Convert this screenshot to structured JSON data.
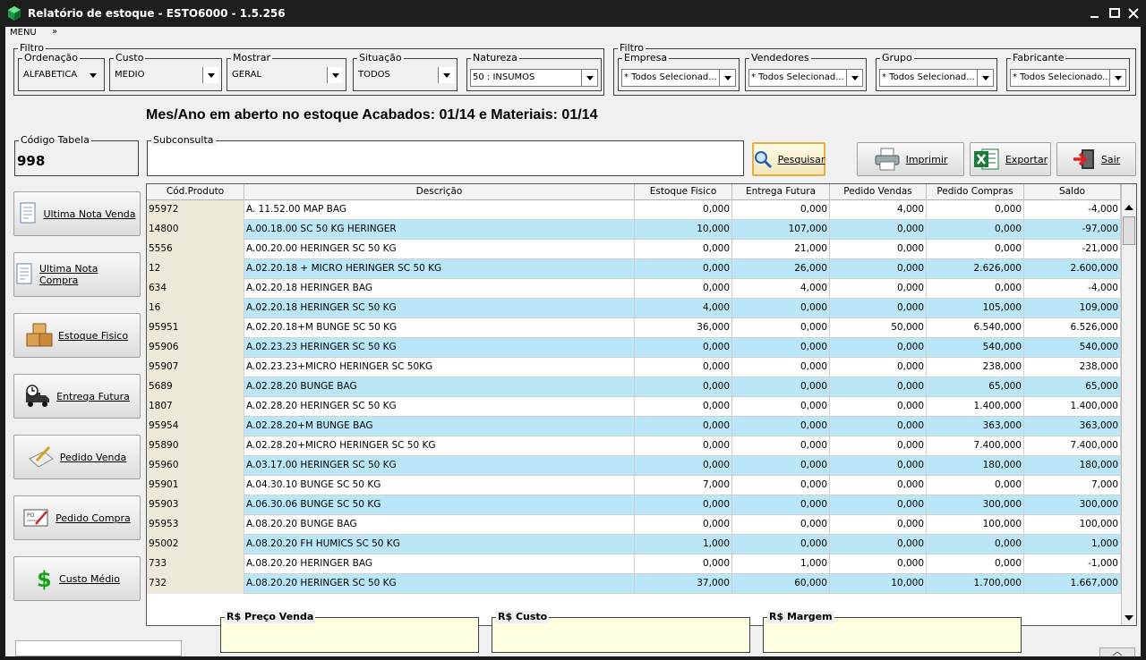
{
  "window": {
    "title": "Relatório de estoque - ESTO6000 - 1.5.256"
  },
  "menu": {
    "label": "MENU",
    "chevron": "»"
  },
  "filter_left": {
    "legend": "Filtro",
    "ordenacao": {
      "label": "Ordenação",
      "value": "ALFABÉTICA"
    },
    "custo": {
      "label": "Custo",
      "value": "MEDIO"
    },
    "mostrar": {
      "label": "Mostrar",
      "value": "GERAL"
    },
    "situacao": {
      "label": "Situação",
      "value": "TODOS"
    },
    "natureza": {
      "label": "Natureza",
      "value": "50 : INSUMOS"
    }
  },
  "filter_right": {
    "legend": "Filtro",
    "empresa": {
      "label": "Empresa",
      "value": "* Todos Selecionad..."
    },
    "vendedores": {
      "label": "Vendedores",
      "value": "* Todos Selecionad..."
    },
    "grupo": {
      "label": "Grupo",
      "value": "* Todos Selecionad..."
    },
    "fabricante": {
      "label": "Fabricante",
      "value": "* Todos Selecionado..."
    }
  },
  "banner": "Mes/Ano em aberto no estoque Acabados: 01/14 e Materiais: 01/14",
  "codigo_tabela": {
    "label": "Código Tabela",
    "value": "998"
  },
  "subconsulta": {
    "label": "Subconsulta",
    "value": ""
  },
  "actions": {
    "pesquisar": "Pesquisar",
    "imprimir": "Imprimir",
    "exportar": "Exportar",
    "sair": "Sair"
  },
  "side_buttons": {
    "ultima_nota_venda": "Ultima Nota Venda",
    "ultima_nota_compra": "Ultima Nota Compra",
    "estoque_fisico": "Estoque Fisico",
    "entrega_futura": "Entrega Futura",
    "pedido_venda": "Pedido Venda",
    "pedido_compra": "Pedido Compra",
    "custo_medio": "Custo Médio"
  },
  "grid": {
    "columns": [
      "Cód.Produto",
      "Descrição",
      "Estoque Fisico",
      "Entrega Futura",
      "Pedido Vendas",
      "Pedido Compras",
      "Saldo"
    ],
    "rows": [
      [
        "95972",
        "A. 11.52.00 MAP BAG",
        "0,000",
        "0,000",
        "4,000",
        "0,000",
        "-4,000"
      ],
      [
        "14800",
        "A.00.18.00 SC 50 KG HERINGER",
        "10,000",
        "107,000",
        "0,000",
        "0,000",
        "-97,000"
      ],
      [
        "5556",
        "A.00.20.00 HERINGER SC 50 KG",
        "0,000",
        "21,000",
        "0,000",
        "0,000",
        "-21,000"
      ],
      [
        "12",
        "A.02.20.18 + MICRO HERINGER SC 50 KG",
        "0,000",
        "26,000",
        "0,000",
        "2.626,000",
        "2.600,000"
      ],
      [
        "634",
        "A.02.20.18 HERINGER BAG",
        "0,000",
        "4,000",
        "0,000",
        "0,000",
        "-4,000"
      ],
      [
        "16",
        "A.02.20.18 HERINGER SC 50 KG",
        "4,000",
        "0,000",
        "0,000",
        "105,000",
        "109,000"
      ],
      [
        "95951",
        "A.02.20.18+M BUNGE SC 50 KG",
        "36,000",
        "0,000",
        "50,000",
        "6.540,000",
        "6.526,000"
      ],
      [
        "95906",
        "A.02.23.23 HERINGER SC 50 KG",
        "0,000",
        "0,000",
        "0,000",
        "540,000",
        "540,000"
      ],
      [
        "95907",
        "A.02.23.23+MICRO HERINGER SC 50KG",
        "0,000",
        "0,000",
        "0,000",
        "238,000",
        "238,000"
      ],
      [
        "5689",
        "A.02.28.20 BUNGE BAG",
        "0,000",
        "0,000",
        "0,000",
        "65,000",
        "65,000"
      ],
      [
        "1807",
        "A.02.28.20 HERINGER SC 50 KG",
        "0,000",
        "0,000",
        "0,000",
        "1.400,000",
        "1.400,000"
      ],
      [
        "95954",
        "A.02.28.20+M BUNGE BAG",
        "0,000",
        "0,000",
        "0,000",
        "363,000",
        "363,000"
      ],
      [
        "95890",
        "A.02.28.20+MICRO HERINGER SC 50 KG",
        "0,000",
        "0,000",
        "0,000",
        "7.400,000",
        "7.400,000"
      ],
      [
        "95960",
        "A.03.17.00 HERINGER SC 50 KG",
        "0,000",
        "0,000",
        "0,000",
        "180,000",
        "180,000"
      ],
      [
        "95901",
        "A.04.30.10 BUNGE SC 50 KG",
        "7,000",
        "0,000",
        "0,000",
        "0,000",
        "7,000"
      ],
      [
        "95903",
        "A.06.30.06 BUNGE SC 50 KG",
        "0,000",
        "0,000",
        "0,000",
        "300,000",
        "300,000"
      ],
      [
        "95953",
        "A.08.20.20 BUNGE BAG",
        "0,000",
        "0,000",
        "0,000",
        "100,000",
        "100,000"
      ],
      [
        "95002",
        "A.08.20.20 FH HUMICS SC 50 KG",
        "1,000",
        "0,000",
        "0,000",
        "0,000",
        "1,000"
      ],
      [
        "733",
        "A.08.20.20 HERINGER BAG",
        "0,000",
        "1,000",
        "0,000",
        "0,000",
        "-1,000"
      ],
      [
        "732",
        "A.08.20.20 HERINGER SC 50 KG",
        "37,000",
        "60,000",
        "10,000",
        "1.700,000",
        "1.667,000"
      ]
    ]
  },
  "totals": {
    "preco_venda": "R$ Preço Venda",
    "custo": "R$ Custo",
    "margem": "R$ Margem"
  }
}
